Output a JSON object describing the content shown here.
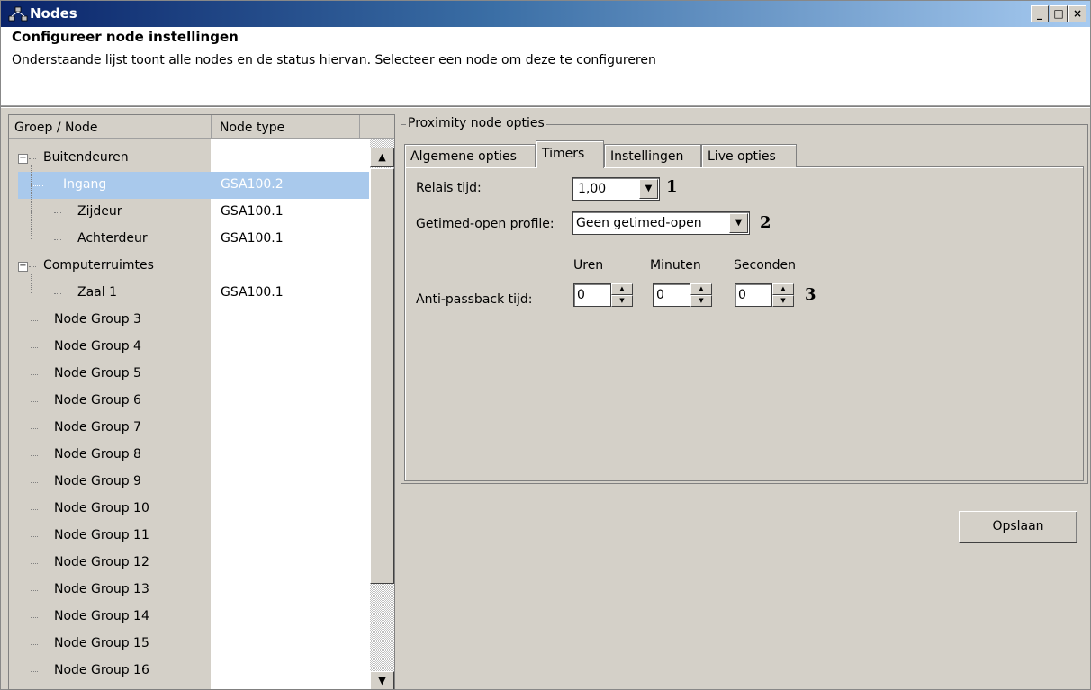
{
  "window": {
    "title": "Nodes"
  },
  "header": {
    "title": "Configureer node instellingen",
    "description": "Onderstaande lijst toont alle nodes en de status hiervan. Selecteer een node om deze te configureren"
  },
  "tree": {
    "columns": [
      "Groep / Node",
      "Node type"
    ],
    "rows": [
      {
        "name": "Buitendeuren",
        "type": ""
      },
      {
        "name": "Ingang",
        "type": "GSA100.2"
      },
      {
        "name": "Zijdeur",
        "type": "GSA100.1"
      },
      {
        "name": "Achterdeur",
        "type": "GSA100.1"
      },
      {
        "name": "Computerruimtes",
        "type": ""
      },
      {
        "name": "Zaal 1",
        "type": "GSA100.1"
      },
      {
        "name": "Node Group 3",
        "type": ""
      },
      {
        "name": "Node Group 4",
        "type": ""
      },
      {
        "name": "Node Group 5",
        "type": ""
      },
      {
        "name": "Node Group 6",
        "type": ""
      },
      {
        "name": "Node Group 7",
        "type": ""
      },
      {
        "name": "Node Group 8",
        "type": ""
      },
      {
        "name": "Node Group 9",
        "type": ""
      },
      {
        "name": "Node Group 10",
        "type": ""
      },
      {
        "name": "Node Group 11",
        "type": ""
      },
      {
        "name": "Node Group 12",
        "type": ""
      },
      {
        "name": "Node Group 13",
        "type": ""
      },
      {
        "name": "Node Group 14",
        "type": ""
      },
      {
        "name": "Node Group 15",
        "type": ""
      },
      {
        "name": "Node Group 16",
        "type": ""
      }
    ]
  },
  "panel": {
    "group_title": "Proximity node opties",
    "tabs": [
      "Algemene opties",
      "Timers",
      "Instellingen",
      "Live opties"
    ],
    "active_tab": "Timers",
    "relais_label": "Relais tijd:",
    "relais_value": "1,00",
    "relais_number": "1",
    "profile_label": "Getimed-open profile:",
    "profile_value": "Geen getimed-open",
    "profile_number": "2",
    "antipassback_label": "Anti-passback tijd:",
    "antipassback_number": "3",
    "spinners": [
      {
        "label": "Uren",
        "value": "0"
      },
      {
        "label": "Minuten",
        "value": "0"
      },
      {
        "label": "Seconden",
        "value": "0"
      }
    ],
    "save_label": "Opslaan"
  }
}
